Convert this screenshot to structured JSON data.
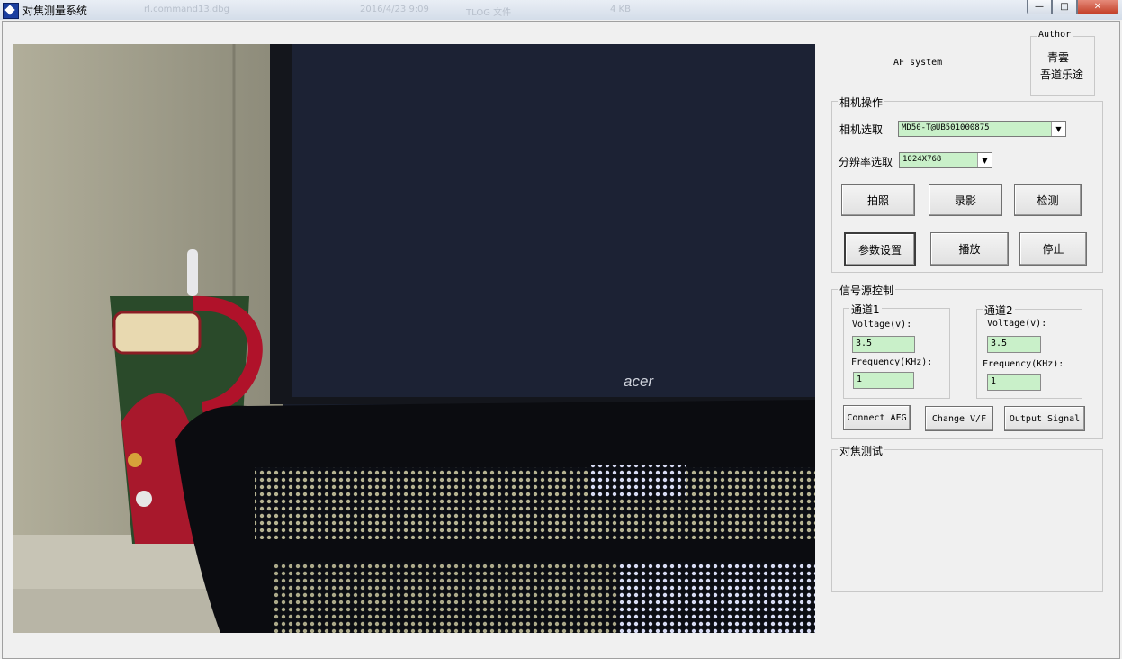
{
  "window": {
    "title": "对焦测量系统",
    "background_ghost_texts": [
      "rl.command13.dbg",
      "2016/4/23 9:09",
      "TLOG 文件",
      "4 KB"
    ],
    "controls": {
      "minimize": "—",
      "maximize": "□",
      "close": "✕"
    }
  },
  "camera_view": {
    "brand_text": "acer"
  },
  "header": {
    "app_label": "AF system",
    "author": {
      "legend": "Author",
      "line1": "青雲",
      "line2": "吾道乐途"
    }
  },
  "camera_ops": {
    "legend": "相机操作",
    "camera_select_label": "相机选取",
    "camera_select_value": "MD50-T@UB501000875",
    "resolution_label": "分辨率选取",
    "resolution_value": "1024X768",
    "buttons": {
      "capture": "拍照",
      "record": "录影",
      "detect": "检测",
      "params": "参数设置",
      "play": "播放",
      "stop": "停止"
    }
  },
  "signal": {
    "legend": "信号源控制",
    "channel1": {
      "legend": "通道1",
      "voltage_label": "Voltage(v):",
      "voltage_value": "3.5",
      "frequency_label": "Frequency(KHz):",
      "frequency_value": "1"
    },
    "channel2": {
      "legend": "通道2",
      "voltage_label": "Voltage(v):",
      "voltage_value": "3.5",
      "frequency_label": "Frequency(KHz):",
      "frequency_value": "1"
    },
    "buttons": {
      "connect": "Connect AFG",
      "change": "Change V/F",
      "output": "Output Signal"
    }
  },
  "focus_test": {
    "legend": "对焦测试"
  },
  "colors": {
    "field_bg": "#c9f0c9",
    "panel_bg": "#f0f0f0"
  }
}
